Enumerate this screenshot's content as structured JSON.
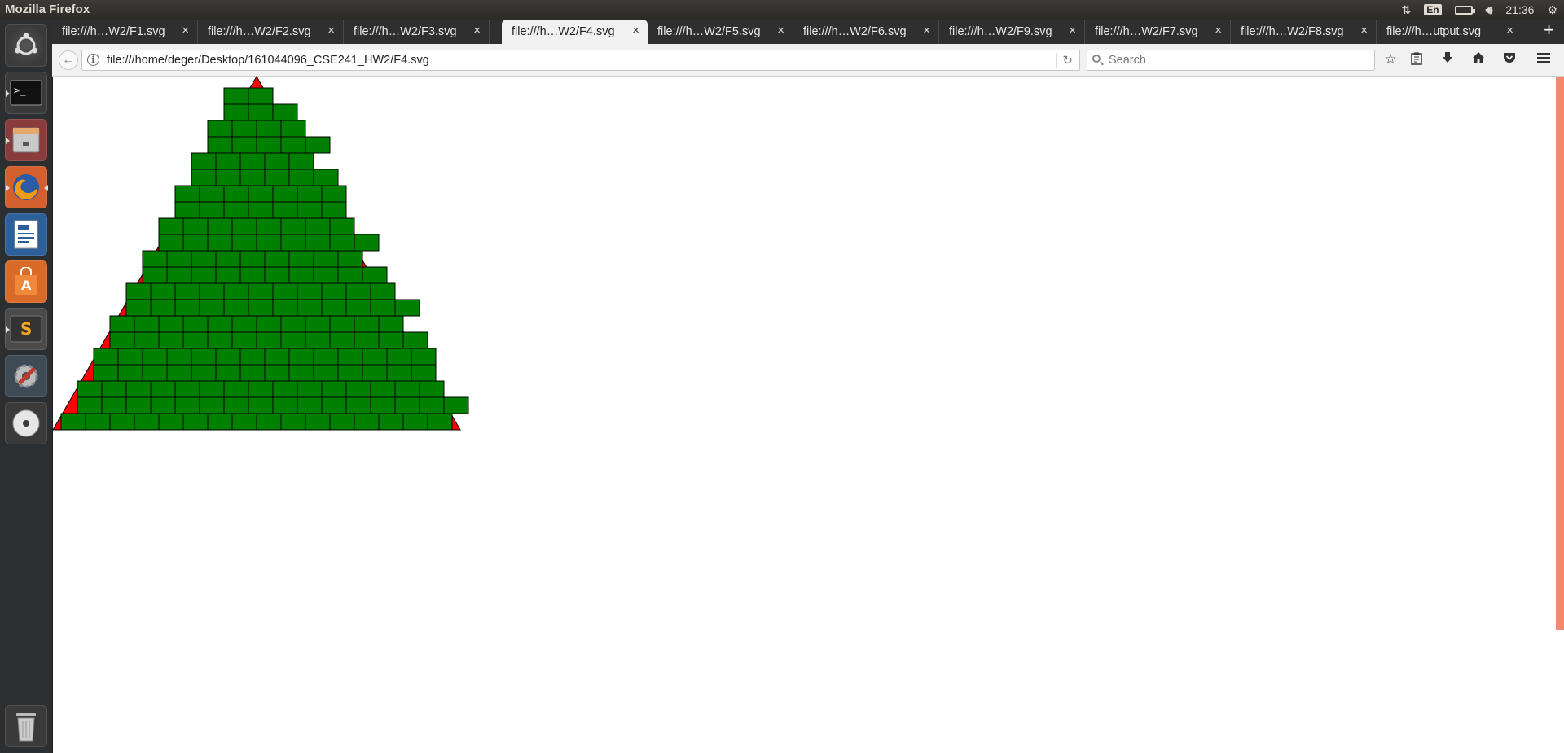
{
  "top_panel": {
    "window_title": "Mozilla Firefox",
    "indicators": {
      "network_icon": "network-updown-icon",
      "keyboard_layout": "En",
      "battery_icon": "battery-icon",
      "volume_icon": "volume-icon",
      "clock": "21:36",
      "session_icon": "gear-icon"
    }
  },
  "launcher": {
    "items": [
      {
        "name": "dash-home",
        "icon": "ubuntu-logo-icon"
      },
      {
        "name": "terminal",
        "icon": "terminal-icon"
      },
      {
        "name": "files",
        "icon": "file-cabinet-icon"
      },
      {
        "name": "firefox",
        "icon": "firefox-icon"
      },
      {
        "name": "writer",
        "icon": "writer-document-icon"
      },
      {
        "name": "software-center",
        "icon": "shopping-bag-icon"
      },
      {
        "name": "sublime-text",
        "icon": "sublime-text-icon"
      },
      {
        "name": "system-settings",
        "icon": "settings-wrench-icon"
      },
      {
        "name": "dvd",
        "icon": "disc-icon"
      },
      {
        "name": "trash",
        "icon": "trash-icon"
      }
    ]
  },
  "tabs": [
    {
      "label": "file:///h…W2/F1.svg",
      "active": false
    },
    {
      "label": "file:///h…W2/F2.svg",
      "active": false
    },
    {
      "label": "file:///h…W2/F3.svg",
      "active": false
    },
    {
      "label": "file:///h…W2/F4.svg",
      "active": true
    },
    {
      "label": "file:///h…W2/F5.svg",
      "active": false
    },
    {
      "label": "file:///h…W2/F6.svg",
      "active": false
    },
    {
      "label": "file:///h…W2/F9.svg",
      "active": false
    },
    {
      "label": "file:///h…W2/F7.svg",
      "active": false
    },
    {
      "label": "file:///h…W2/F8.svg",
      "active": false
    },
    {
      "label": "file:///h…utput.svg",
      "active": false
    }
  ],
  "tab_close_glyph": "×",
  "new_tab_glyph": "+",
  "navbar": {
    "back_glyph": "←",
    "url": "file:///home/deger/Desktop/161044096_CSE241_HW2/F4.svg",
    "reload_glyph": "↻",
    "search_placeholder": "Search",
    "toolbar_icons": [
      "star-bookmark-icon",
      "reading-list-icon",
      "download-icon",
      "home-icon",
      "pocket-icon",
      "hamburger-menu-icon"
    ]
  },
  "svg_document": {
    "triangle_color": "#ff0000",
    "brick_color": "#008000",
    "outline_color": "#000000",
    "brick_rows": 21
  },
  "colors": {
    "scrollbar": "#f08a70"
  }
}
